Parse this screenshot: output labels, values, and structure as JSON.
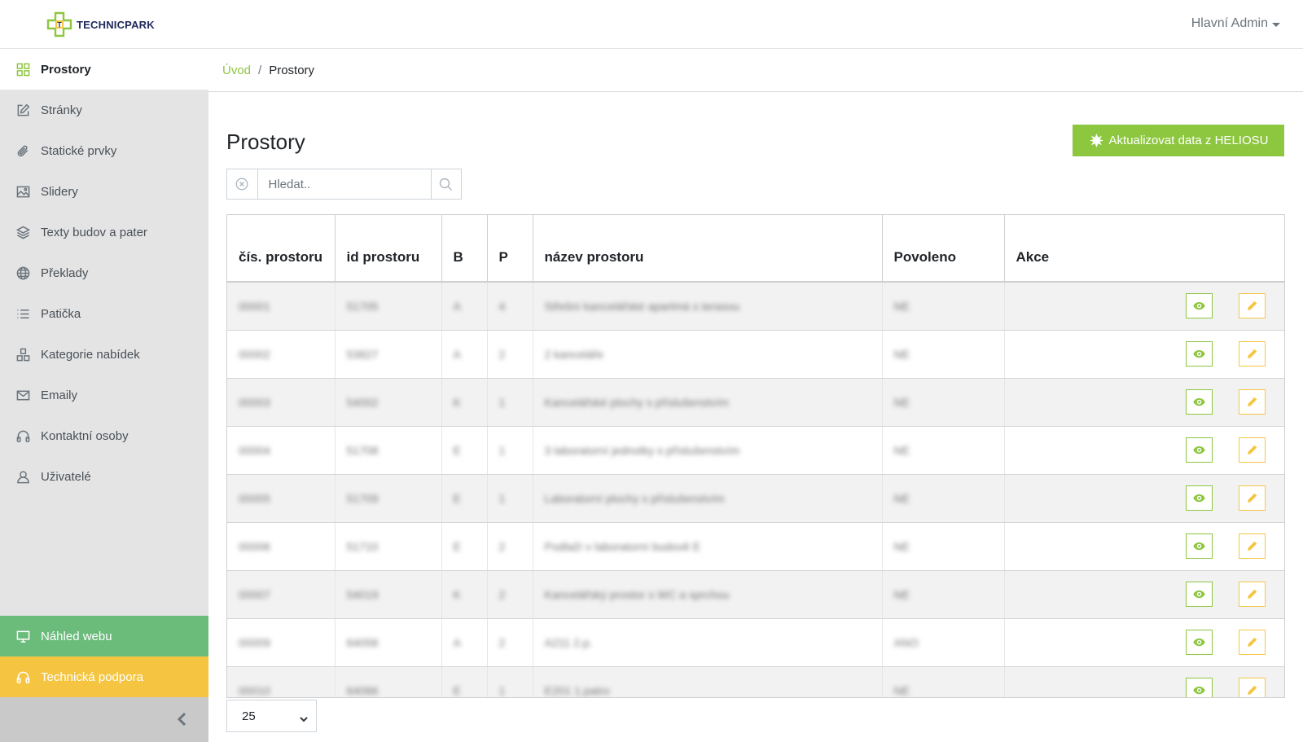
{
  "header": {
    "logo_text": "TECHNICPARK",
    "user": "Hlavní Admin"
  },
  "sidebar": {
    "items": [
      {
        "label": "Prostory",
        "icon": "grid-icon"
      },
      {
        "label": "Stránky",
        "icon": "edit-icon"
      },
      {
        "label": "Statické prvky",
        "icon": "paperclip-icon"
      },
      {
        "label": "Slidery",
        "icon": "image-icon"
      },
      {
        "label": "Texty budov a pater",
        "icon": "layers-icon"
      },
      {
        "label": "Překlady",
        "icon": "globe-icon"
      },
      {
        "label": "Patička",
        "icon": "list-icon"
      },
      {
        "label": "Kategorie nabídek",
        "icon": "categories-icon"
      },
      {
        "label": "Emaily",
        "icon": "mail-icon"
      },
      {
        "label": "Kontaktní osoby",
        "icon": "headphones-icon"
      },
      {
        "label": "Uživatelé",
        "icon": "user-icon"
      }
    ],
    "preview": "Náhled webu",
    "support": "Technická podpora"
  },
  "breadcrumb": {
    "home": "Úvod",
    "separator": "/",
    "current": "Prostory"
  },
  "main": {
    "title": "Prostory",
    "helios_button": "Aktualizovat data z HELIOSU",
    "search_placeholder": "Hledat..",
    "page_size": "25"
  },
  "table": {
    "headers": [
      "čís. prostoru",
      "id prostoru",
      "B",
      "P",
      "název prostoru",
      "Povoleno",
      "Akce"
    ],
    "rows": [
      [
        "00001",
        "51705",
        "A",
        "4",
        "Střešní kancelářské apartmá s terasou",
        "NE"
      ],
      [
        "00002",
        "53827",
        "A",
        "2",
        "2 kanceláře",
        "NE"
      ],
      [
        "00003",
        "54002",
        "K",
        "1",
        "Kancelářské plochy s příslušenstvím",
        "NE"
      ],
      [
        "00004",
        "51708",
        "E",
        "1",
        "3 laboratorní jednotky s příslušenstvím",
        "NE"
      ],
      [
        "00005",
        "51709",
        "E",
        "1",
        "Laboratorní plochy s příslušenstvím",
        "NE"
      ],
      [
        "00006",
        "51710",
        "E",
        "2",
        "Podlaží v laboratorní budově E",
        "NE"
      ],
      [
        "00007",
        "54019",
        "K",
        "2",
        "Kancelářský prostor s WC a sprchou",
        "NE"
      ],
      [
        "00009",
        "64058",
        "A",
        "2",
        "A211 2.p.",
        "ANO"
      ],
      [
        "00010",
        "64066",
        "E",
        "1",
        "E201 1.patro",
        "NE"
      ]
    ]
  },
  "colors": {
    "accent_green": "#8dc63f",
    "preview_green": "#6bbb7b",
    "support_yellow": "#f5c542",
    "sidebar_bg": "#e4e4e4"
  }
}
